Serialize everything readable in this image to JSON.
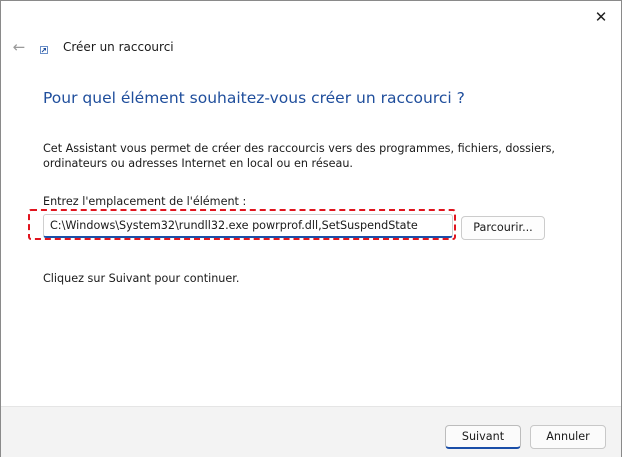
{
  "window": {
    "title": "Créer un raccourci",
    "close_icon": "close-icon",
    "back_icon": "back-arrow-icon",
    "app_icon": "shortcut-wizard-icon"
  },
  "main": {
    "heading": "Pour quel élément souhaitez-vous créer un raccourci ?",
    "description": "Cet Assistant vous permet de créer des raccourcis vers des programmes, fichiers, dossiers, ordinateurs ou adresses Internet en local ou en réseau.",
    "location_label": "Entrez l'emplacement de l'élément :",
    "location_value": "C:\\Windows\\System32\\rundll32.exe powrprof.dll,SetSuspendState",
    "browse_label": "Parcourir...",
    "instruction": "Cliquez sur Suivant pour continuer."
  },
  "footer": {
    "next_label": "Suivant",
    "cancel_label": "Annuler"
  },
  "colors": {
    "heading": "#1f4e9c",
    "highlight": "#e0141e",
    "focus_accent": "#1a4ea8"
  }
}
